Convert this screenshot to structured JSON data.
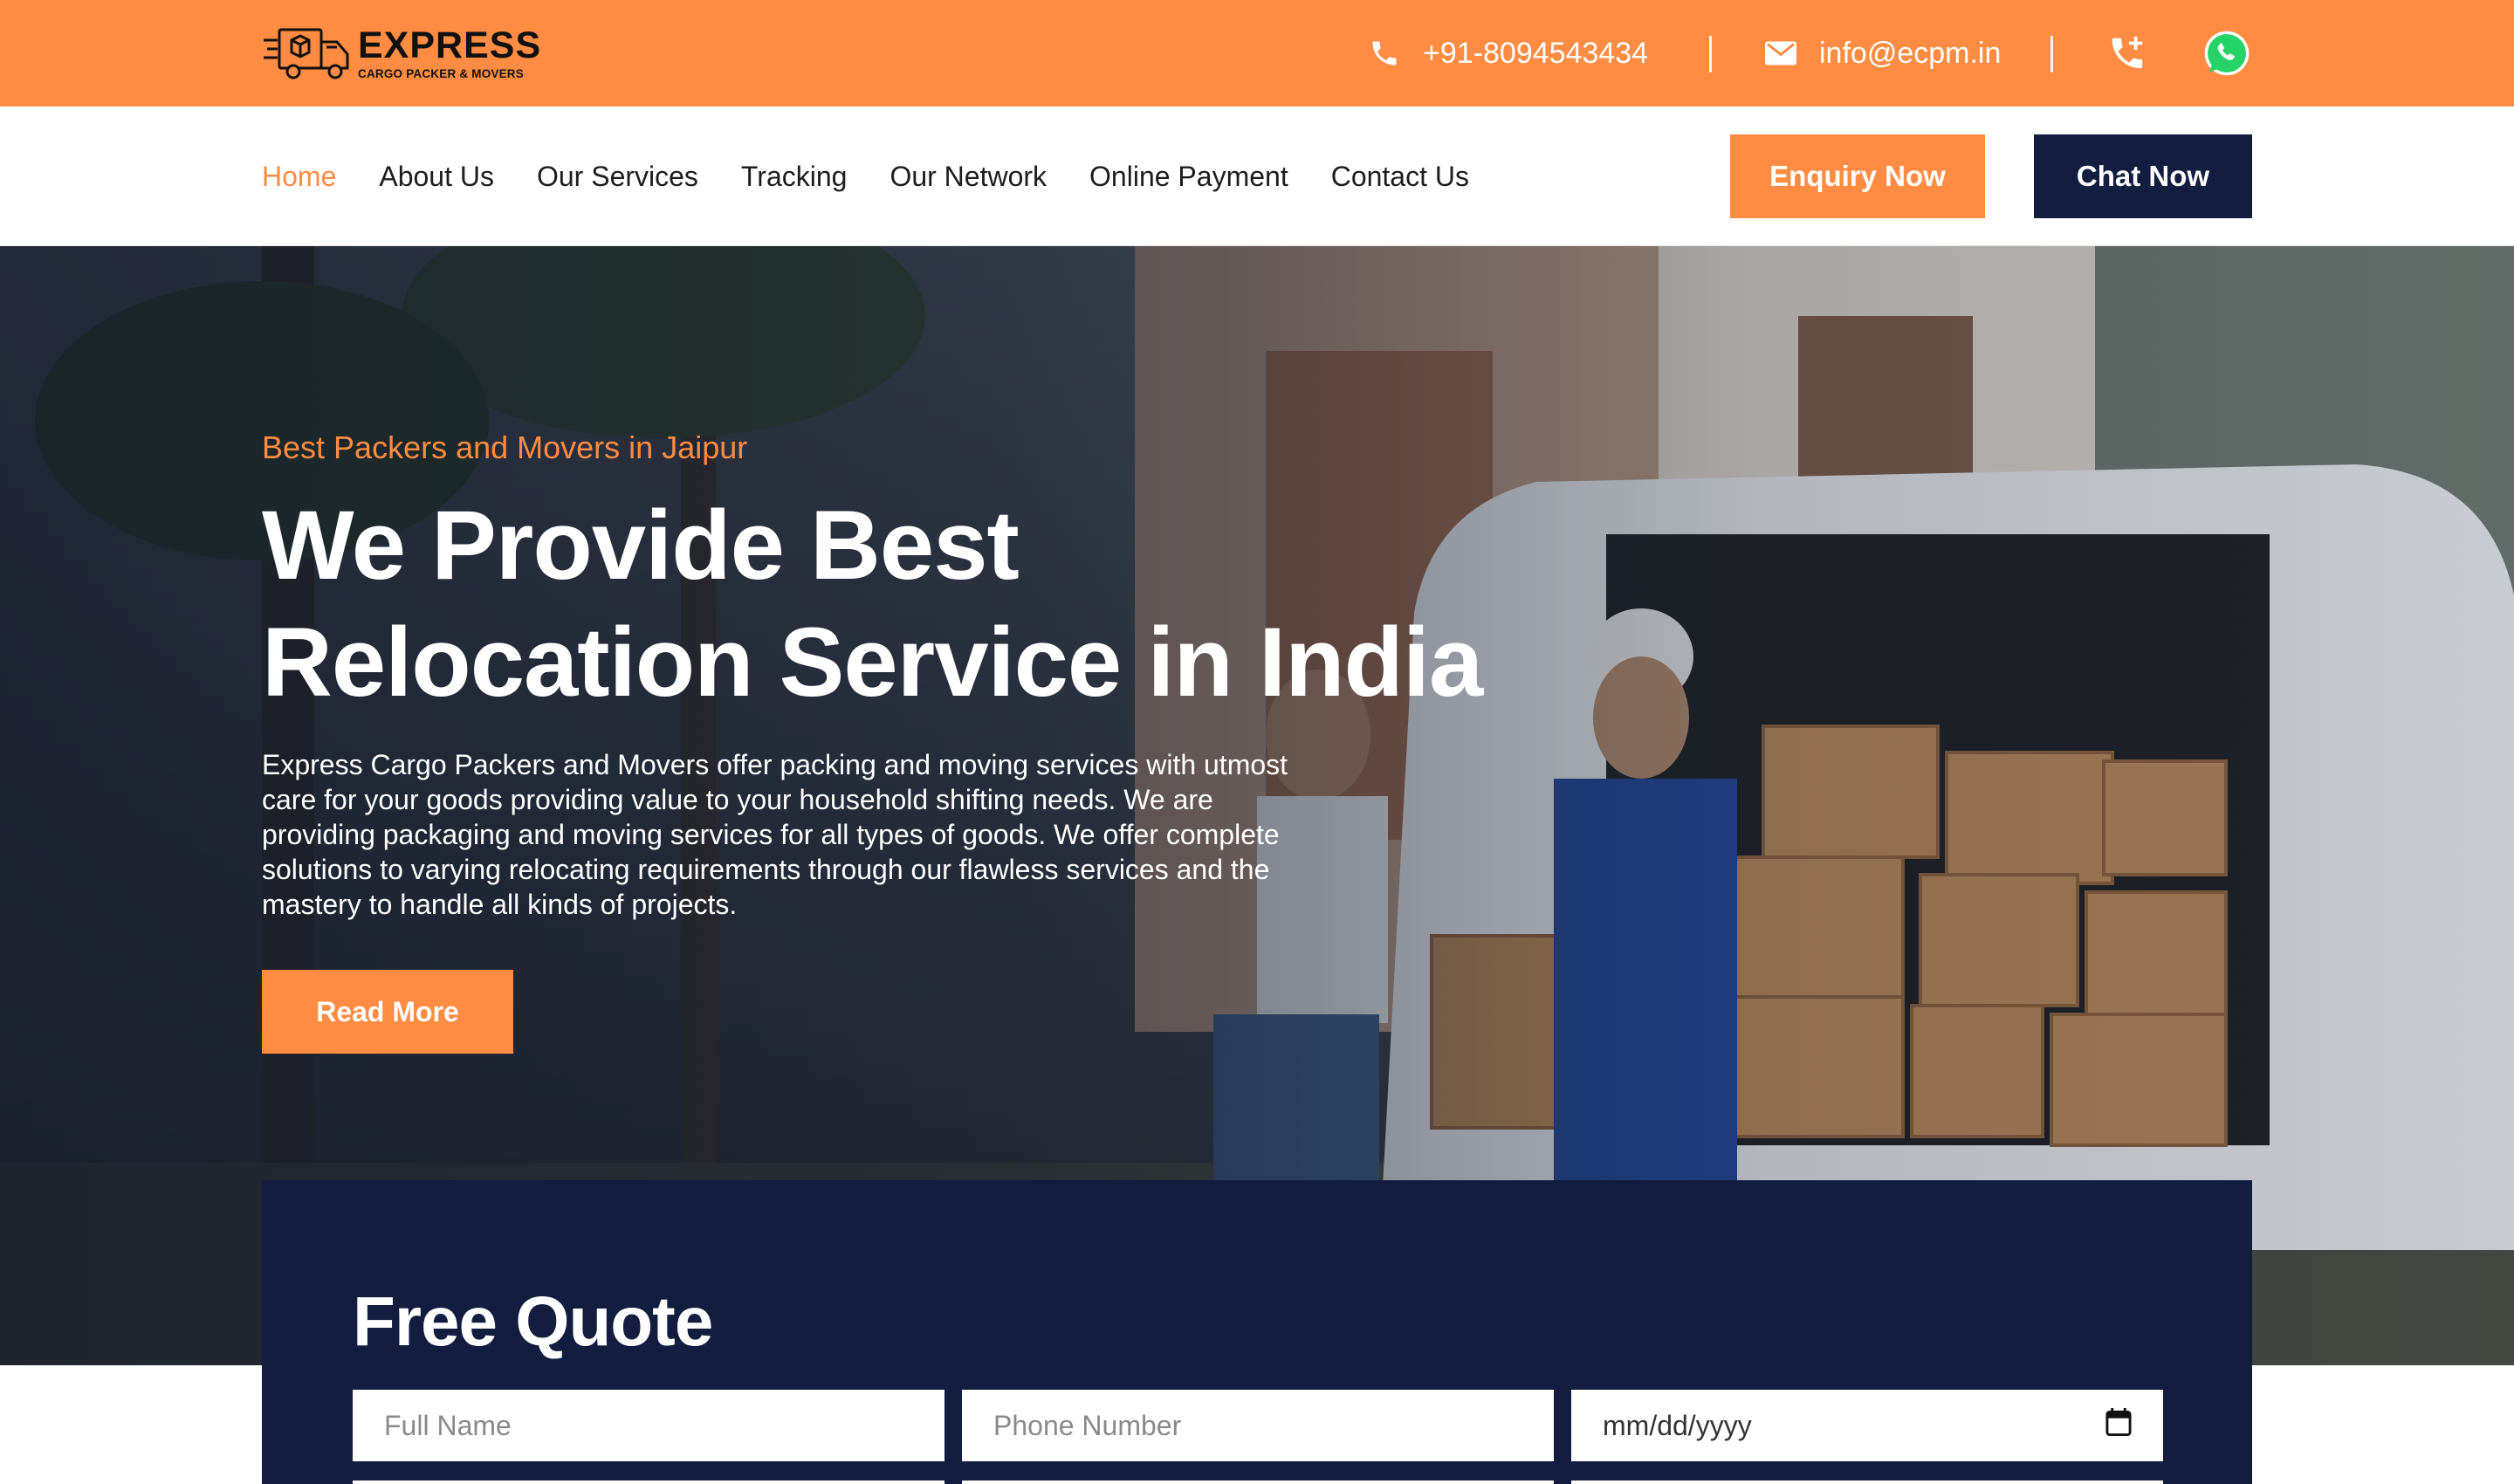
{
  "brand": {
    "name": "EXPRESS",
    "subtitle": "CARGO PACKER & MOVERS"
  },
  "topbar": {
    "phone": "+91-8094543434",
    "email": "info@ecpm.in",
    "phone_icon": "phone-icon",
    "email_icon": "mail-icon",
    "call_icon": "phone-plus-icon",
    "whatsapp_icon": "whatsapp-icon"
  },
  "nav": {
    "items": [
      {
        "label": "Home",
        "active": true
      },
      {
        "label": "About Us",
        "active": false
      },
      {
        "label": "Our Services",
        "active": false
      },
      {
        "label": "Tracking",
        "active": false
      },
      {
        "label": "Our Network",
        "active": false
      },
      {
        "label": "Online Payment",
        "active": false
      },
      {
        "label": "Contact Us",
        "active": false
      }
    ],
    "enquiry_label": "Enquiry Now",
    "chat_label": "Chat Now"
  },
  "hero": {
    "tagline": "Best Packers and Movers in Jaipur",
    "headline_line1": "We Provide Best",
    "headline_line2": "Relocation Service in India",
    "description": "Express Cargo Packers and Movers offer packing and moving services with utmost care for your goods providing value to your household shifting needs. We are providing packaging and moving services for all types of goods. We offer complete solutions to varying relocating requirements through our flawless services and the mastery to handle all kinds of projects.",
    "read_more_label": "Read More"
  },
  "quote": {
    "title": "Free Quote",
    "full_name_placeholder": "Full Name",
    "phone_placeholder": "Phone Number",
    "date_placeholder": "mm/dd/yyyy",
    "date_icon": "calendar-icon"
  },
  "colors": {
    "accent": "#FF8C42",
    "navy": "#121D3F"
  }
}
